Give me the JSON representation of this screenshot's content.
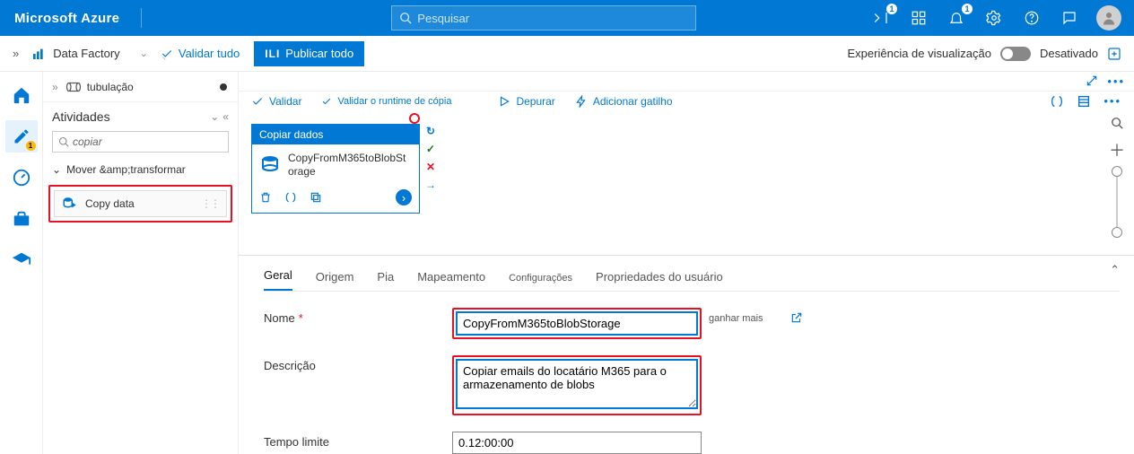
{
  "azure": {
    "brand": "Microsoft Azure",
    "search_placeholder": "Pesquisar",
    "notif_badge": "1",
    "bell_badge": "1"
  },
  "adfbar": {
    "breadcrumb": "Data Factory",
    "validate_all": "Validar tudo",
    "publish_pre": "ILI",
    "publish": "Publicar todo",
    "preview_label": "Experiência de visualização",
    "preview_state": "Desativado"
  },
  "tabstrip": {
    "pipeline": "tubulação"
  },
  "activities": {
    "title": "Atividades",
    "search_value": "copiar",
    "group": "Mover &amp;transformar",
    "item": "Copy data"
  },
  "toolbar": {
    "validate": "Validar",
    "validate_runtime": "Validar o runtime de cópia",
    "debug": "Depurar",
    "add_trigger": "Adicionar gatilho"
  },
  "node": {
    "type": "Copiar dados",
    "name": "CopyFromM365toBlobStorage"
  },
  "tabs": {
    "general": "Geral",
    "source": "Origem",
    "sink": "Pia",
    "mapping": "Mapeamento",
    "settings": "Configurações",
    "user_props": "Propriedades do usuário"
  },
  "fields": {
    "name_label": "Nome",
    "name_value": "CopyFromM365toBlobStorage",
    "learn_more": "ganhar mais",
    "desc_label": "Descrição",
    "desc_value": "Copiar emails do locatário M365 para o armazenamento de blobs",
    "timeout_label": "Tempo limite",
    "timeout_value": "0.12:00:00"
  },
  "rail": {
    "pencil_badge": "1"
  }
}
